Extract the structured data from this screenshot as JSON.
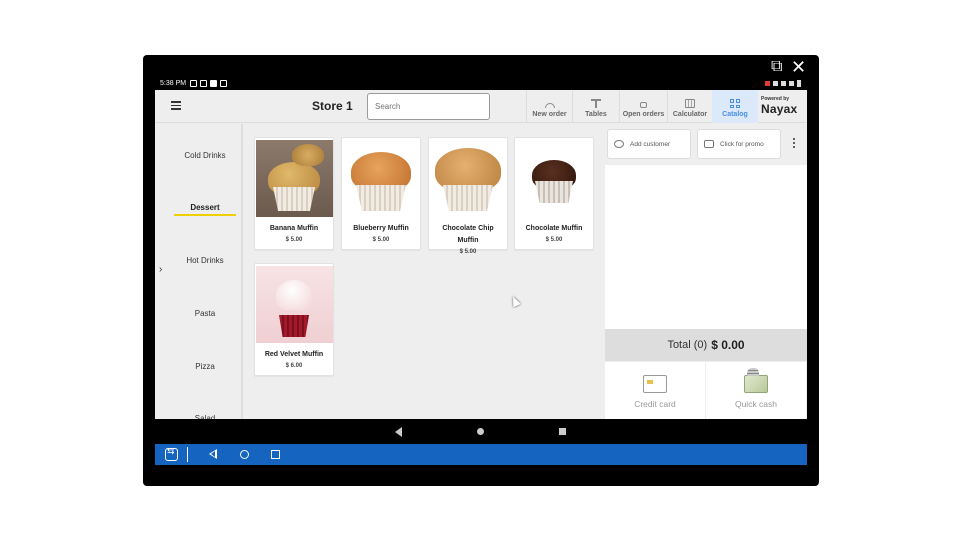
{
  "status_bar": {
    "time": "5:38 PM"
  },
  "header": {
    "store_title": "Store 1",
    "search_placeholder": "Search",
    "nav": [
      {
        "label": "New order",
        "icon": "new-order-icon"
      },
      {
        "label": "Tables",
        "icon": "tables-icon"
      },
      {
        "label": "Open orders",
        "icon": "lock-icon"
      },
      {
        "label": "Calculator",
        "icon": "calculator-icon"
      },
      {
        "label": "Catalog",
        "icon": "grid-icon",
        "active": true
      }
    ],
    "brand_small": "Powered by",
    "brand": "Nayax"
  },
  "sidebar": {
    "categories": [
      "Cold Drinks",
      "Dessert",
      "Hot Drinks",
      "Pasta",
      "Pizza",
      "Salad"
    ],
    "active": "Dessert"
  },
  "products": [
    {
      "name": "Banana Muffin",
      "price": "$ 5.00"
    },
    {
      "name": "Blueberry Muffin",
      "price": "$ 5.00"
    },
    {
      "name": "Chocolate Chip Muffin",
      "price": "$ 5.00"
    },
    {
      "name": "Chocolate Muffin",
      "price": "$ 5.00"
    },
    {
      "name": "Red Velvet Muffin",
      "price": "$ 6.00"
    }
  ],
  "order_panel": {
    "add_customer": "Add customer",
    "promo": "Click for promo",
    "total_label": "Total (0)",
    "total_amount": "$ 0.00",
    "pay_card": "Credit card",
    "pay_cash": "Quick cash"
  },
  "colors": {
    "accent": "#4a8fe0",
    "active_underline": "#f0d000",
    "teamviewer_bar": "#1565c0"
  }
}
